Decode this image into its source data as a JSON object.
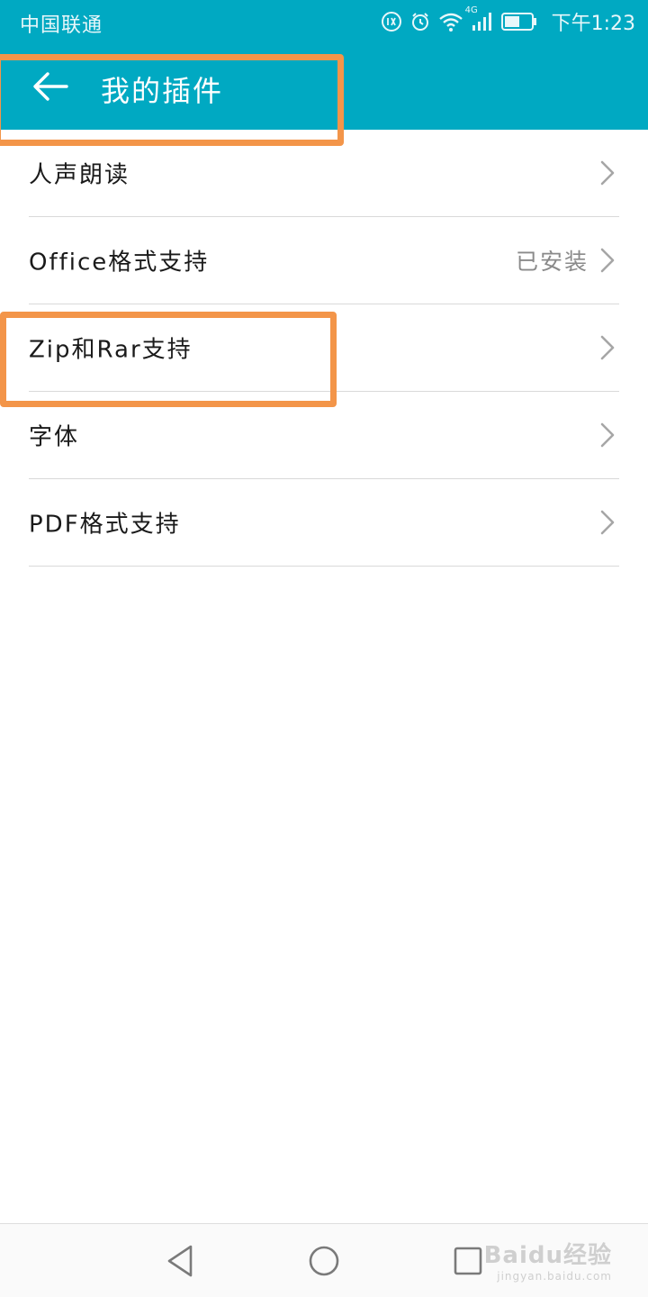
{
  "status_bar": {
    "carrier": "中国联通",
    "network": "4G",
    "time": "下午1:23"
  },
  "header": {
    "title": "我的插件"
  },
  "plugins": [
    {
      "label": "人声朗读",
      "status": ""
    },
    {
      "label": "Office格式支持",
      "status": "已安装"
    },
    {
      "label": "Zip和Rar支持",
      "status": ""
    },
    {
      "label": "字体",
      "status": ""
    },
    {
      "label": "PDF格式支持",
      "status": ""
    }
  ],
  "watermark": {
    "main": "Baidu经验",
    "sub": "jingyan.baidu.com"
  },
  "colors": {
    "accent": "#00a9c2",
    "highlight": "#f39549"
  },
  "icons": {
    "back": "arrow-left-icon",
    "chevron": "chevron-right-icon",
    "nav_back": "triangle-back-icon",
    "nav_home": "circle-home-icon",
    "nav_recent": "square-recent-icon"
  }
}
